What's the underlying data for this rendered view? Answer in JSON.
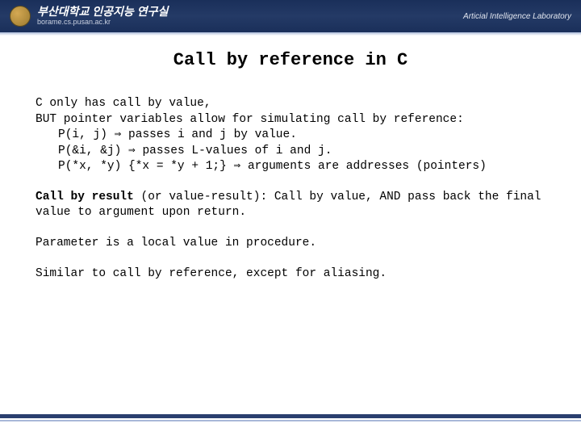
{
  "header": {
    "korean": "부산대학교 인공지능 연구실",
    "url": "borame.cs.pusan.ac.kr",
    "lab": "Articial Intelligence Laboratory"
  },
  "title": "Call by reference in C",
  "p1": {
    "line1": "C only has call by value,",
    "line2": "BUT pointer variables allow for simulating call by reference:",
    "code1_a": "P(i, j) ",
    "code1_b": " passes i and j by value.",
    "code2_a": "P(&i, &j) ",
    "code2_b": " passes L-values of i and j.",
    "code3_a": "P(*x, *y) {*x = *y + 1;} ",
    "code3_b": " arguments are addresses (pointers)"
  },
  "p2_bold": "Call by result",
  "p2_rest": " (or value-result): Call by value, AND pass back the final value to argument upon return.",
  "p3": "Parameter is a local value in procedure.",
  "p4": "Similar to call by reference, except for aliasing.",
  "arrow": "⇒"
}
